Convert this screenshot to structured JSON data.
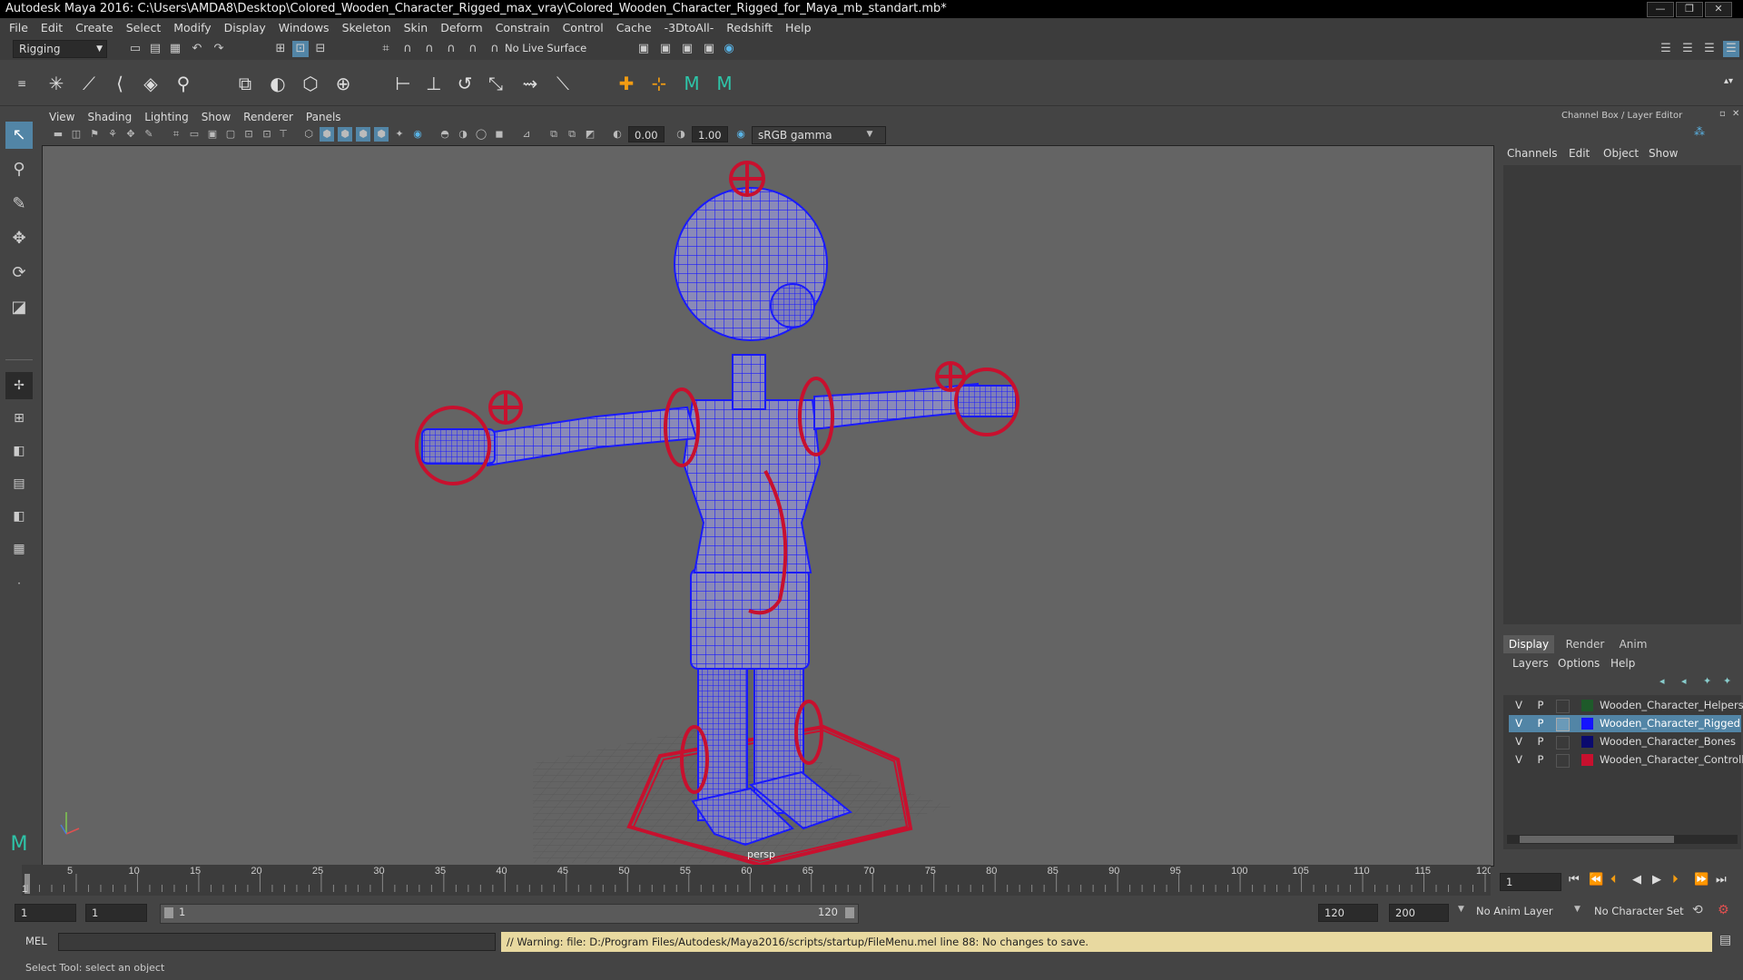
{
  "title": "Autodesk Maya 2016: C:\\Users\\AMDA8\\Desktop\\Colored_Wooden_Character_Rigged_max_vray\\Colored_Wooden_Character_Rigged_for_Maya_mb_standart.mb*",
  "window_buttons": [
    "—",
    "❐",
    "✕"
  ],
  "menu": [
    "File",
    "Edit",
    "Create",
    "Select",
    "Modify",
    "Display",
    "Windows",
    "Skeleton",
    "Skin",
    "Deform",
    "Constrain",
    "Control",
    "Cache",
    "-3DtoAll-",
    "Redshift",
    "Help"
  ],
  "status": {
    "mode": "Rigging",
    "live_surface": "No Live Surface"
  },
  "viewport_menu": [
    "View",
    "Shading",
    "Lighting",
    "Show",
    "Renderer",
    "Panels"
  ],
  "viewport_fields": {
    "exposure": "0.00",
    "gamma": "1.00",
    "colorspace": "sRGB gamma"
  },
  "camera_label": "persp",
  "channel_box": {
    "header": "Channel Box / Layer Editor",
    "menu": [
      "Channels",
      "Edit",
      "Object",
      "Show"
    ]
  },
  "layer_editor": {
    "tabs": [
      "Display",
      "Render",
      "Anim"
    ],
    "menu": [
      "Layers",
      "Options",
      "Help"
    ],
    "layers": [
      {
        "v": "V",
        "p": "P",
        "name": "Wooden_Character_Helpers",
        "color": "#1e5a2a",
        "selected": false
      },
      {
        "v": "V",
        "p": "P",
        "name": "Wooden_Character_Rigged",
        "color": "#1414ff",
        "selected": true
      },
      {
        "v": "V",
        "p": "P",
        "name": "Wooden_Character_Bones",
        "color": "#0a0a6e",
        "selected": false
      },
      {
        "v": "V",
        "p": "P",
        "name": "Wooden_Character_Controllers",
        "color": "#c8102e",
        "selected": false
      }
    ]
  },
  "timeline": {
    "ticks": [
      "5",
      "10",
      "15",
      "20",
      "25",
      "30",
      "35",
      "40",
      "45",
      "50",
      "55",
      "60",
      "65",
      "70",
      "75",
      "80",
      "85",
      "90",
      "95",
      "100",
      "105",
      "110",
      "115",
      "120"
    ],
    "start_tick": "1",
    "current_frame": "1"
  },
  "range": {
    "start": "1",
    "playback_start": "1",
    "slider_start": "1",
    "slider_end": "120",
    "end": "120",
    "anim_end": "200",
    "anim_layer": "No Anim Layer",
    "char_set": "No Character Set"
  },
  "cmd": {
    "lang": "MEL",
    "warning": "// Warning: file: D:/Program Files/Autodesk/Maya2016/scripts/startup/FileMenu.mel line 88: No changes to save."
  },
  "help_line": "Select Tool: select an object",
  "colors": {
    "mesh": "#1a1aff",
    "controller": "#c8102e",
    "warning_bg": "#e8d9a0",
    "selection": "#5285a6"
  }
}
